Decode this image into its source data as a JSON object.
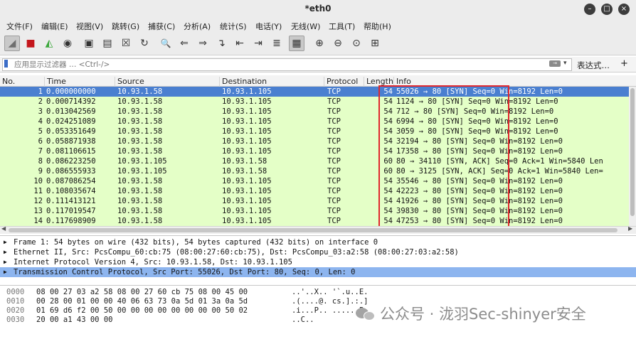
{
  "window": {
    "title": "*eth0",
    "buttons": [
      "minimize",
      "maximize",
      "close"
    ]
  },
  "menu": [
    "文件(F)",
    "编辑(E)",
    "视图(V)",
    "跳转(G)",
    "捕获(C)",
    "分析(A)",
    "统计(S)",
    "电话(Y)",
    "无线(W)",
    "工具(T)",
    "帮助(H)"
  ],
  "toolbar": {
    "icons": [
      "shark-fin-start-icon",
      "stop-square-icon",
      "restart-fin-icon",
      "capture-options-gear-icon",
      "open-folder-icon",
      "save-file-icon",
      "close-file-icon",
      "reload-icon",
      "find-magnifier-icon",
      "go-back-arrow-icon",
      "go-forward-arrow-icon",
      "go-to-packet-icon",
      "first-packet-icon",
      "last-packet-icon",
      "auto-scroll-icon",
      "colorize-lines-icon",
      "zoom-in-icon",
      "zoom-out-icon",
      "zoom-normal-icon",
      "resize-columns-icon"
    ],
    "glyphs": [
      "◢",
      "■",
      "◭",
      "◉",
      "▣",
      "▤",
      "☒",
      "↻",
      "🔍",
      "⇐",
      "⇒",
      "↴",
      "⇤",
      "⇥",
      "≣",
      "▦",
      "⊕",
      "⊖",
      "⊙",
      "⊞"
    ]
  },
  "filter": {
    "placeholder": "应用显示过滤器 … <Ctrl-/>",
    "expression_label": "表达式…",
    "add_label": "+",
    "arrow_label": "→"
  },
  "packet_list": {
    "columns": [
      "No.",
      "Time",
      "Source",
      "Destination",
      "Protocol",
      "Length",
      "Info"
    ],
    "rows": [
      {
        "no": "1",
        "time": "0.000000000",
        "src": "10.93.1.58",
        "dst": "10.93.1.105",
        "proto": "TCP",
        "len": "54",
        "info": "55026 → 80 [SYN] Seq=0 Win=8192 Len=0"
      },
      {
        "no": "2",
        "time": "0.000714392",
        "src": "10.93.1.58",
        "dst": "10.93.1.105",
        "proto": "TCP",
        "len": "54",
        "info": "1124 → 80 [SYN] Seq=0 Win=8192 Len=0"
      },
      {
        "no": "3",
        "time": "0.013042569",
        "src": "10.93.1.58",
        "dst": "10.93.1.105",
        "proto": "TCP",
        "len": "54",
        "info": "712 → 80 [SYN] Seq=0 Win=8192 Len=0"
      },
      {
        "no": "4",
        "time": "0.024251089",
        "src": "10.93.1.58",
        "dst": "10.93.1.105",
        "proto": "TCP",
        "len": "54",
        "info": "6994 → 80 [SYN] Seq=0 Win=8192 Len=0"
      },
      {
        "no": "5",
        "time": "0.053351649",
        "src": "10.93.1.58",
        "dst": "10.93.1.105",
        "proto": "TCP",
        "len": "54",
        "info": "3059 → 80 [SYN] Seq=0 Win=8192 Len=0"
      },
      {
        "no": "6",
        "time": "0.058871938",
        "src": "10.93.1.58",
        "dst": "10.93.1.105",
        "proto": "TCP",
        "len": "54",
        "info": "32194 → 80 [SYN] Seq=0 Win=8192 Len=0"
      },
      {
        "no": "7",
        "time": "0.081106615",
        "src": "10.93.1.58",
        "dst": "10.93.1.105",
        "proto": "TCP",
        "len": "54",
        "info": "17358 → 80 [SYN] Seq=0 Win=8192 Len=0"
      },
      {
        "no": "8",
        "time": "0.086223250",
        "src": "10.93.1.105",
        "dst": "10.93.1.58",
        "proto": "TCP",
        "len": "60",
        "info": "80 → 34110 [SYN, ACK] Seq=0 Ack=1 Win=5840 Len"
      },
      {
        "no": "9",
        "time": "0.086555933",
        "src": "10.93.1.105",
        "dst": "10.93.1.58",
        "proto": "TCP",
        "len": "60",
        "info": "80 → 3125 [SYN, ACK] Seq=0 Ack=1 Win=5840 Len="
      },
      {
        "no": "10",
        "time": "0.087086254",
        "src": "10.93.1.58",
        "dst": "10.93.1.105",
        "proto": "TCP",
        "len": "54",
        "info": "35546 → 80 [SYN] Seq=0 Win=8192 Len=0"
      },
      {
        "no": "11",
        "time": "0.108035674",
        "src": "10.93.1.58",
        "dst": "10.93.1.105",
        "proto": "TCP",
        "len": "54",
        "info": "42223 → 80 [SYN] Seq=0 Win=8192 Len=0"
      },
      {
        "no": "12",
        "time": "0.111413121",
        "src": "10.93.1.58",
        "dst": "10.93.1.105",
        "proto": "TCP",
        "len": "54",
        "info": "41926 → 80 [SYN] Seq=0 Win=8192 Len=0"
      },
      {
        "no": "13",
        "time": "0.117019547",
        "src": "10.93.1.58",
        "dst": "10.93.1.105",
        "proto": "TCP",
        "len": "54",
        "info": "39830 → 80 [SYN] Seq=0 Win=8192 Len=0"
      },
      {
        "no": "14",
        "time": "0.117698909",
        "src": "10.93.1.58",
        "dst": "10.93.1.105",
        "proto": "TCP",
        "len": "54",
        "info": "47253 → 80 [SYN] Seq=0 Win=8192 Len=0"
      }
    ]
  },
  "details": [
    {
      "arrow": "▶",
      "text": "Frame 1: 54 bytes on wire (432 bits), 54 bytes captured (432 bits) on interface 0"
    },
    {
      "arrow": "▶",
      "text": "Ethernet II, Src: PcsCompu_60:cb:75 (08:00:27:60:cb:75), Dst: PcsCompu_03:a2:58 (08:00:27:03:a2:58)"
    },
    {
      "arrow": "▶",
      "text": "Internet Protocol Version 4, Src: 10.93.1.58, Dst: 10.93.1.105"
    },
    {
      "arrow": "▶",
      "text": "Transmission Control Protocol, Src Port: 55026, Dst Port: 80, Seq: 0, Len: 0"
    }
  ],
  "bytes": [
    {
      "offset": "0000",
      "hex": "08 00 27 03 a2 58 08 00  27 60 cb 75 08 00 45 00",
      "ascii": "..'..X.. '`.u..E."
    },
    {
      "offset": "0010",
      "hex": "00 28 00 01 00 00 40 06  63 73 0a 5d 01 3a 0a 5d",
      "ascii": ".(....@. cs.].:.]"
    },
    {
      "offset": "0020",
      "hex": "01 69 d6 f2 00 50 00 00  00 00 00 00 00 00 50 02",
      "ascii": ".i...P.. ......P."
    },
    {
      "offset": "0030",
      "hex": "20 00 a1 43 00 00",
      "ascii": " ..C.."
    }
  ],
  "watermark": {
    "text": "公众号 · 泷羽Sec-shinyer安全"
  },
  "colors": {
    "row_green": "#e4ffc7",
    "selected_blue": "#4a7fd0",
    "detail_selected": "#8db5ef",
    "highlight_box": "#e0272d"
  }
}
